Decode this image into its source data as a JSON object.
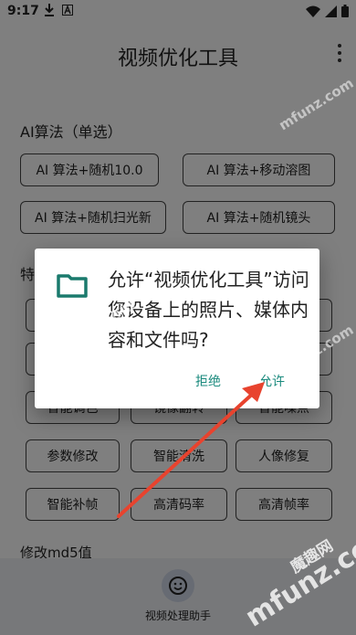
{
  "status_bar": {
    "time": "9:17"
  },
  "app_bar": {
    "title": "视频优化工具"
  },
  "section_ai": {
    "title": "AI算法（单选）",
    "buttons": [
      "AI 算法+随机10.0",
      "AI 算法+移动溶图",
      "AI 算法+随机扫光新",
      "AI 算法+随机镜头"
    ]
  },
  "section_special": {
    "title_partial": "特",
    "row1": [
      "智能调色",
      "镜像翻转",
      "智能噪点"
    ],
    "row2": [
      "参数修改",
      "智能清洗",
      "人像修复"
    ],
    "row3": [
      "智能补帧",
      "高清码率",
      "高清帧率"
    ]
  },
  "section_md5": {
    "title": "修改md5值"
  },
  "bottom_nav": {
    "label": "视频处理助手"
  },
  "dialog": {
    "message": "允许“视频优化工具”访问您设备上的照片、媒体内容和文件吗?",
    "deny_label": "拒绝",
    "allow_label": "允许"
  },
  "watermark": {
    "text": "mfunz.com",
    "logo_text": "魔趣网"
  },
  "colors": {
    "accent": "#1a8a7d",
    "annotation": "#e8432e",
    "scrim": "rgba(0,0,0,0.5)"
  }
}
